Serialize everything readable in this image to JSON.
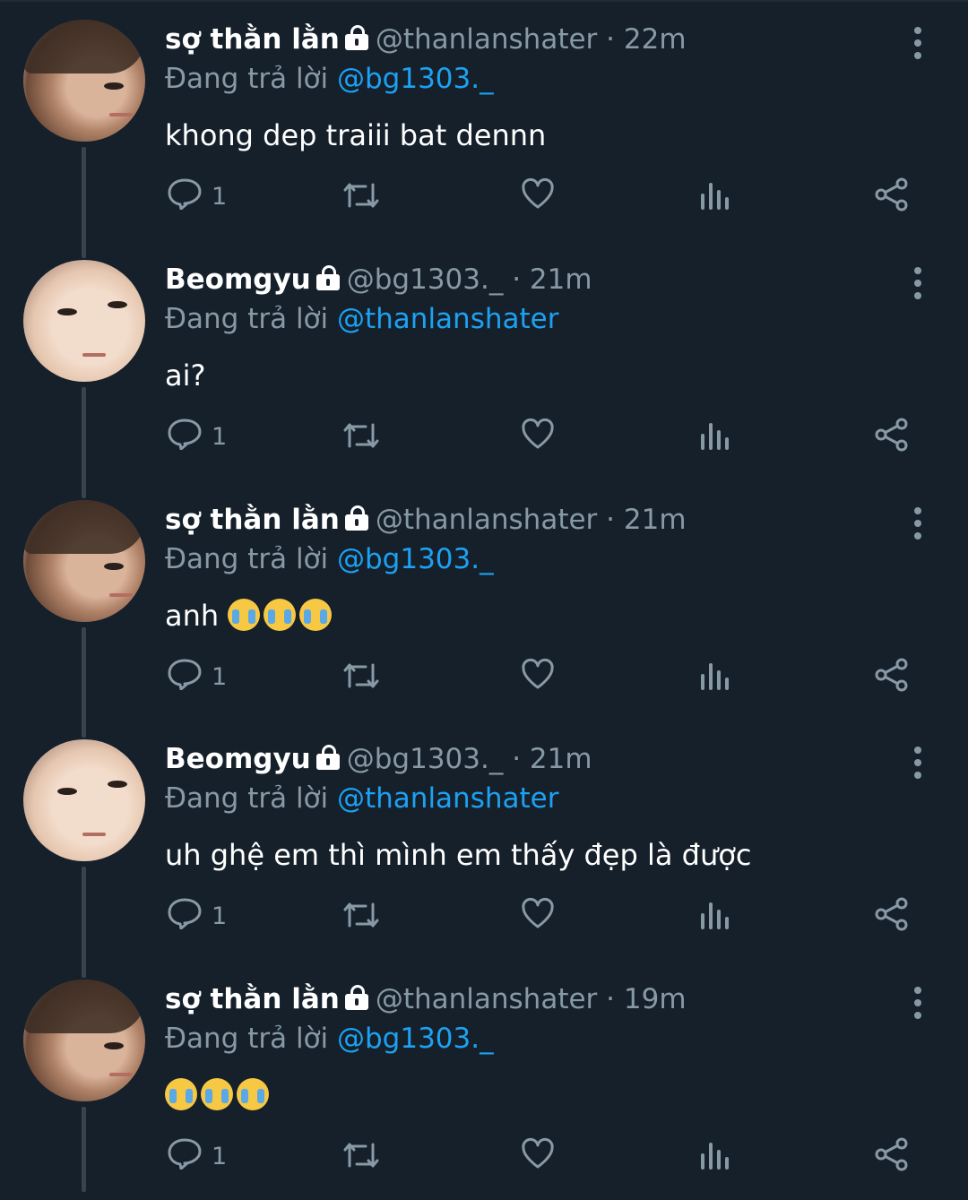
{
  "colors": {
    "background": "#15202b",
    "muted": "#8899a6",
    "accent": "#1da1f2",
    "text": "#ffffff"
  },
  "icons": [
    "reply-icon",
    "retweet-icon",
    "like-icon",
    "analytics-icon",
    "share-icon",
    "more-icon",
    "lock-icon"
  ],
  "tweets": [
    {
      "name": "sợ thằn lằn",
      "handle": "@thanlanshater",
      "time": "· 22m",
      "replying_prefix": "Đang trả lời",
      "replying_to": "@bg1303._",
      "text": "khong dep traiii bat dennn",
      "emoji_count": 0,
      "reply_count": "1"
    },
    {
      "name": "Beomgyu",
      "handle": "@bg1303._",
      "time": "· 21m",
      "replying_prefix": "Đang trả lời",
      "replying_to": "@thanlanshater",
      "text": "ai?",
      "emoji_count": 0,
      "reply_count": "1"
    },
    {
      "name": "sợ thằn lằn",
      "handle": "@thanlanshater",
      "time": "· 21m",
      "replying_prefix": "Đang trả lời",
      "replying_to": "@bg1303._",
      "text": "anh",
      "emoji_count": 3,
      "reply_count": "1"
    },
    {
      "name": "Beomgyu",
      "handle": "@bg1303._",
      "time": "· 21m",
      "replying_prefix": "Đang trả lời",
      "replying_to": "@thanlanshater",
      "text": "uh ghệ em thì mình em thấy đẹp là được",
      "emoji_count": 0,
      "reply_count": "1"
    },
    {
      "name": "sợ thằn lằn",
      "handle": "@thanlanshater",
      "time": "· 19m",
      "replying_prefix": "Đang trả lời",
      "replying_to": "@bg1303._",
      "text": "",
      "emoji_count": 3,
      "reply_count": "1"
    }
  ]
}
